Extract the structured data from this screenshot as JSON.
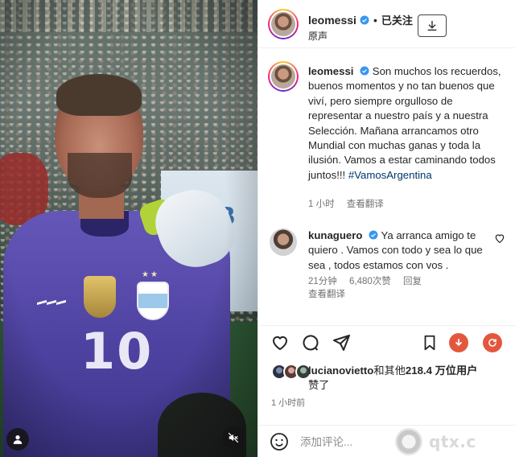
{
  "colors": {
    "verified_blue": "#3897f0",
    "hashtag": "#00376b",
    "muted_text": "#737373",
    "accent_red": "#e4573f",
    "jersey_purple": "#5a4db0"
  },
  "media": {
    "jersey_number": "10",
    "banner_text": "B",
    "user_tag_icon": "user-tag-icon",
    "mute_icon": "speaker-muted-icon"
  },
  "header": {
    "username": "leomessi",
    "follow_status": "已关注",
    "subtitle": "原声",
    "download_icon": "download-icon"
  },
  "caption": {
    "username": "leomessi",
    "text": "Son muchos los recuerdos, buenos momentos y no tan buenos que viví, pero siempre orgulloso de representar a nuestro país y a nuestra Selección. Mañana arrancamos otro Mundial con muchas ganas y toda la ilusión. Vamos a estar caminando todos juntos!!! ",
    "hashtag": "#VamosArgentina",
    "time": "1 小时",
    "translate": "查看翻译"
  },
  "comment": {
    "username": "kunaguero",
    "text": "Ya arranca amigo te quiero . Vamos con todo y sea lo que sea , todos estamos con vos .",
    "time": "21分钟",
    "likes": "6,480次赞",
    "reply": "回复",
    "translate": "查看翻译"
  },
  "actions": {
    "like_icon": "heart-icon",
    "comment_icon": "comment-icon",
    "share_icon": "send-icon",
    "save_icon": "bookmark-icon",
    "download_icon": "download-circle-icon",
    "refresh_icon": "refresh-circle-icon"
  },
  "likes": {
    "liker": "lucianovietto",
    "rest": "和其他",
    "count": "218.4 万位用户",
    "suffix": "赞了",
    "time_ago": "1 小时前"
  },
  "composer": {
    "placeholder": "添加评论..."
  },
  "watermark": {
    "text": "qtx.c"
  }
}
